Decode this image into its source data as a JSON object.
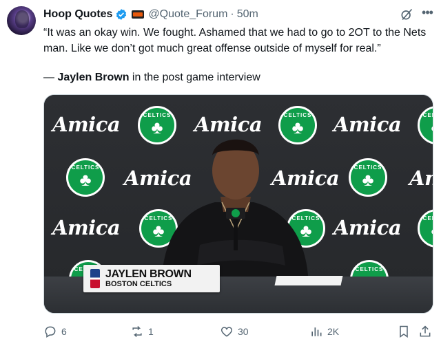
{
  "tweet": {
    "display_name": "Hoop Quotes",
    "handle": "@Quote_Forum",
    "separator": "·",
    "time": "50m",
    "text": "“It was an okay win. We fought. Ashamed that we had to go to 2OT to the Nets man. Like we don’t got much great offense outside of myself for real.”",
    "attribution_dash": "— ",
    "attribution_name": "Jaylen Brown",
    "attribution_rest": " in the post game interview"
  },
  "media": {
    "sponsor": "Amica",
    "logo_text": "CELTICS",
    "lower_third": {
      "name": "JAYLEN BROWN",
      "team": "BOSTON CELTICS"
    }
  },
  "actions": {
    "replies": "6",
    "reposts": "1",
    "likes": "30",
    "views": "2K"
  },
  "colors": {
    "accent": "#1d9bf0",
    "muted": "#536471",
    "celtics_green": "#0f9d4a"
  }
}
